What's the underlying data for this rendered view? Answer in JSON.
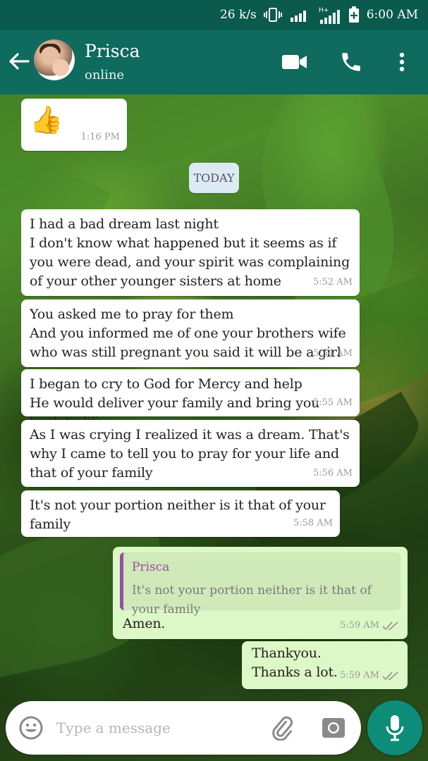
{
  "status_bar": {
    "speed": "26 k/s",
    "network": "H+",
    "time": "6:00 AM"
  },
  "header": {
    "contact_name": "Prisca",
    "contact_status": "online",
    "icons": [
      "back-arrow-icon",
      "video-call-icon",
      "phone-icon",
      "more-options-icon"
    ]
  },
  "date_divider": "TODAY",
  "messages": [
    {
      "direction": "incoming",
      "content": "👍",
      "time": "1:16 PM"
    },
    {
      "direction": "incoming",
      "content": "I had a bad dream last night\nI don't know what happened but it seems as if you were dead, and your spirit was complaining of your other younger sisters at home",
      "time": "5:52 AM"
    },
    {
      "direction": "incoming",
      "content": "You asked me to pray for them\nAnd you informed me of one your brothers wife who was still pregnant you said it will be a girl",
      "time": "5:54 AM"
    },
    {
      "direction": "incoming",
      "content": "I began to cry to God for Mercy and help He would deliver your family and bring you back to life",
      "time": "5:55 AM"
    },
    {
      "direction": "incoming",
      "content": "As I was crying I realized it was a dream. That's why I came to tell you to pray for your life and that of your family",
      "time": "5:56 AM"
    },
    {
      "direction": "incoming",
      "content": "It's not your portion neither is it that of your family",
      "time": "5:58 AM"
    },
    {
      "direction": "outgoing",
      "quote_name": "Prisca",
      "quote_text": "It's not your portion neither is it that of your family",
      "content": "Amen.",
      "time": "5:59 AM",
      "status": "read"
    },
    {
      "direction": "outgoing",
      "content": "Thankyou.\nThanks a lot.",
      "time": "5:59 AM",
      "status": "read"
    }
  ],
  "composer": {
    "placeholder": "Type a message",
    "icons": [
      "emoji-icon",
      "attach-icon",
      "camera-icon",
      "microphone-icon"
    ]
  },
  "colors": {
    "header": "#0e6b5d",
    "status_bar": "#0b5a4e",
    "incoming_bubble": "#ffffff",
    "outgoing_bubble": "#dcf8c6",
    "read_ticks": "#9a9a9a",
    "quote_accent": "#9a4ba4",
    "mic_button": "#0e8c7a"
  }
}
